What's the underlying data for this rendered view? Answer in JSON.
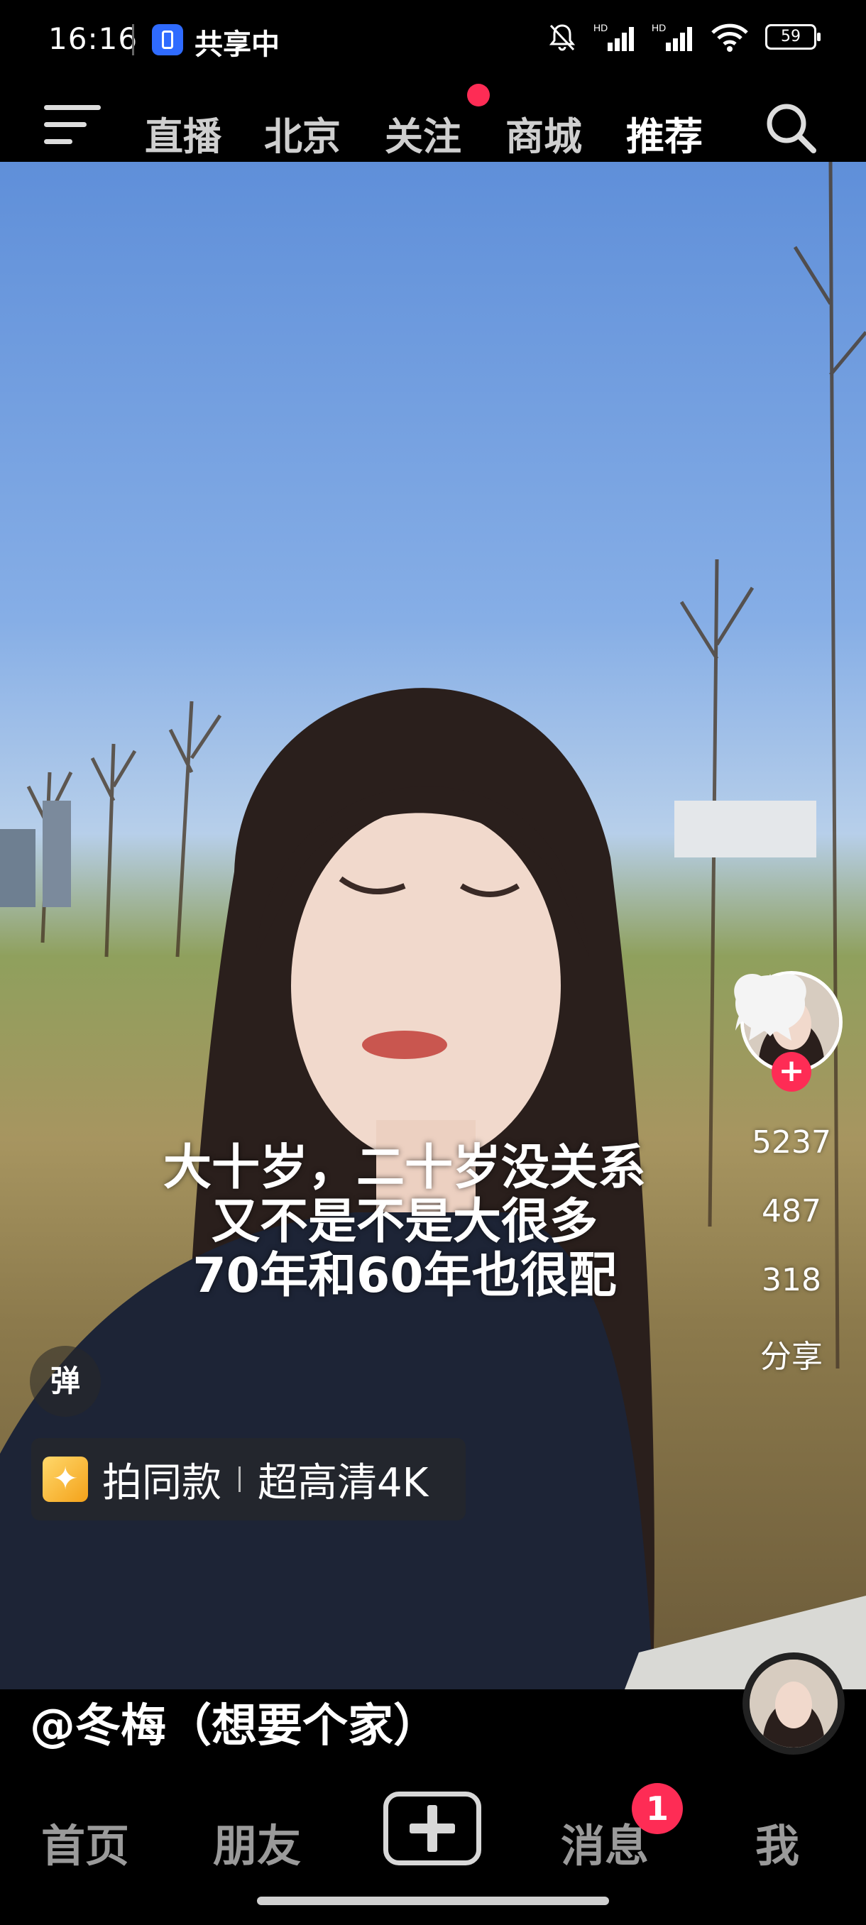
{
  "status_bar": {
    "time": "16:16",
    "sharing_label": "共享中",
    "battery": "59",
    "signal_label_1": "HD",
    "signal_label_2": "HD"
  },
  "top_tabs": [
    {
      "label": "直播"
    },
    {
      "label": "北京"
    },
    {
      "label": "关注"
    },
    {
      "label": "商城"
    },
    {
      "label": "推荐"
    }
  ],
  "active_tab": "推荐",
  "video": {
    "caption_lines": [
      "大十岁，二十岁没关系",
      "又不是不是大很多",
      "70年和60年也很配"
    ],
    "author": "@冬梅（想要个家）",
    "likes": "5237",
    "comments": "487",
    "favorites": "318",
    "share_label": "分享",
    "danmu_label": "弹",
    "same_style_label": "拍同款",
    "quality_label": "超高清4K"
  },
  "bottom_nav": {
    "home": "首页",
    "friends": "朋友",
    "messages": "消息",
    "me": "我",
    "messages_badge": "1"
  },
  "colors": {
    "accent_red": "#fe2c55",
    "background": "#000000"
  },
  "icons": [
    "menu-icon",
    "search-icon",
    "heart-icon",
    "comment-icon",
    "star-icon",
    "share-icon",
    "plus-icon",
    "sparkle-icon",
    "mute-icon",
    "wifi-icon",
    "battery-icon"
  ]
}
